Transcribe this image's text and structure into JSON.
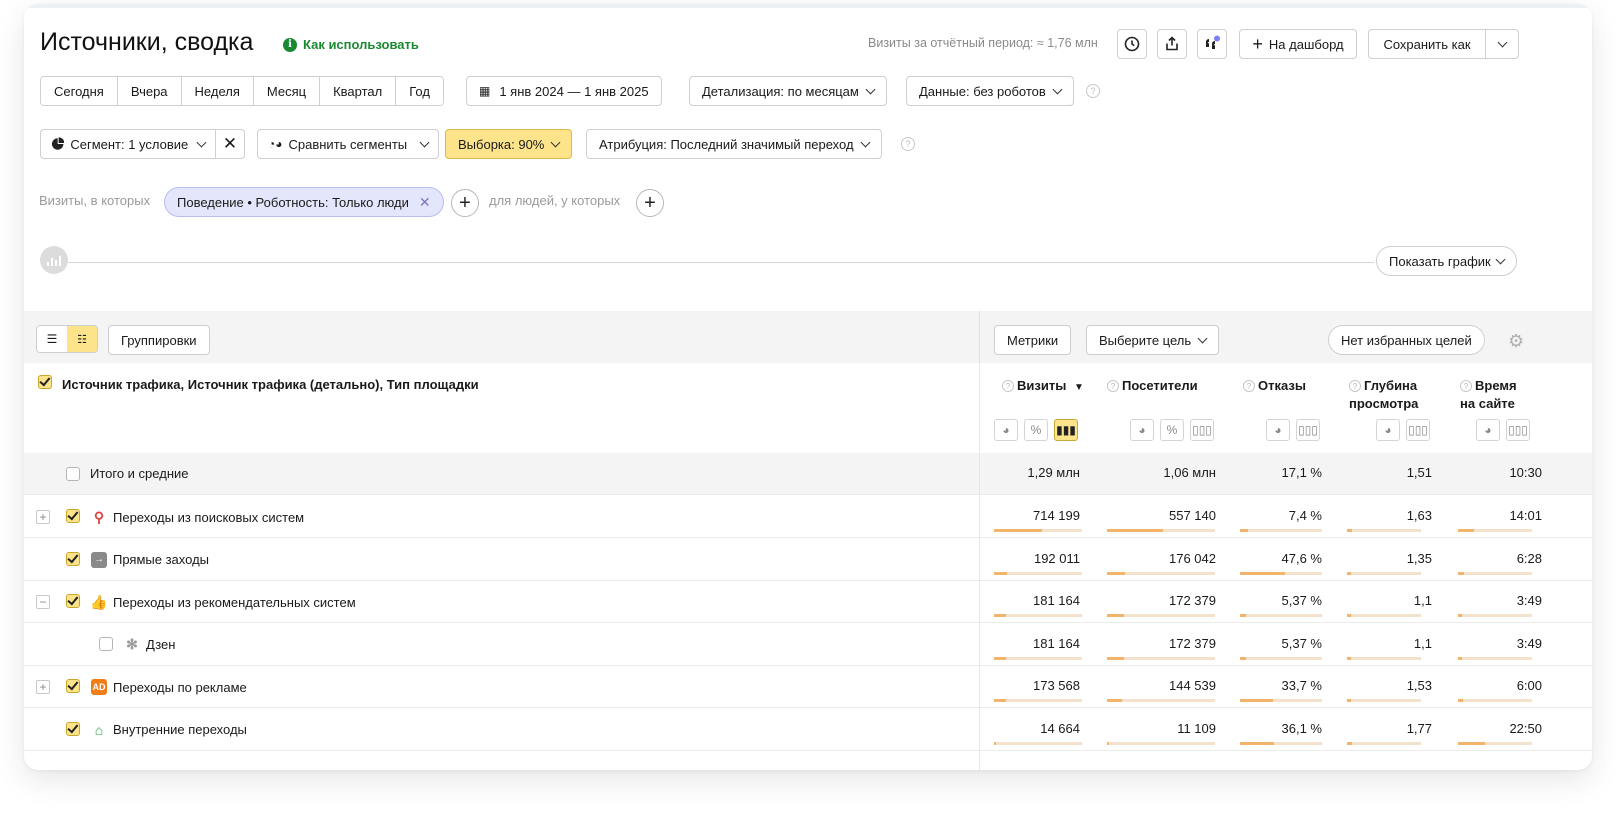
{
  "header": {
    "title": "Источники, сводка",
    "howto": "Как использовать",
    "visits_note": "Визиты за отчётный период: ≈ 1,76 млн",
    "to_dashboard": "На дашборд",
    "save_as": "Сохранить как"
  },
  "periods": [
    "Сегодня",
    "Вчера",
    "Неделя",
    "Месяц",
    "Квартал",
    "Год"
  ],
  "date_range": "1 янв 2024 — 1 янв 2025",
  "detail": "Детализация: по месяцам",
  "data_filter": "Данные: без роботов",
  "segment": "Сегмент: 1 условие",
  "compare": "Сравнить сегменты",
  "sample": "Выборка: 90%",
  "attribution": "Атрибуция: Последний значимый переход",
  "filter": {
    "visits_where": "Визиты, в которых",
    "chip": "Поведение • Роботность: Только люди",
    "people_where": "для людей, у которых"
  },
  "show_chart": "Показать график",
  "toolbar": {
    "groupings": "Группировки",
    "metrics": "Метрики",
    "goal": "Выберите цель",
    "no_fav": "Нет избранных целей"
  },
  "table": {
    "dimension": "Источник трафика, Источник трафика (детально), Тип площадки",
    "columns": [
      {
        "label": "Визиты",
        "sort": "▼"
      },
      {
        "label": "Посетители"
      },
      {
        "label": "Отказы"
      },
      {
        "label1": "Глубина",
        "label2": "просмотра"
      },
      {
        "label1": "Время",
        "label2": "на сайте"
      }
    ],
    "total": {
      "label": "Итого и средние",
      "values": [
        "1,29 млн",
        "1,06 млн",
        "17,1 %",
        "1,51",
        "10:30"
      ]
    },
    "rows": [
      {
        "label": "Переходы из поисковых систем",
        "expander": "+",
        "icon": "search-icon",
        "values": [
          "714 199",
          "557 140",
          "7,4 %",
          "1,63",
          "14:01"
        ],
        "fill": [
          0.55,
          0.52,
          0.1,
          0.07,
          0.22
        ]
      },
      {
        "label": "Прямые заходы",
        "expander": "",
        "icon": "direct-icon",
        "values": [
          "192 011",
          "176 042",
          "47,6 %",
          "1,35",
          "6:28"
        ],
        "fill": [
          0.15,
          0.17,
          0.55,
          0.06,
          0.08
        ]
      },
      {
        "label": "Переходы из рекомендательных систем",
        "expander": "−",
        "icon": "thumb-icon",
        "values": [
          "181 164",
          "172 379",
          "5,37 %",
          "1,1",
          "3:49"
        ],
        "fill": [
          0.14,
          0.16,
          0.07,
          0.05,
          0.05
        ]
      },
      {
        "label": "Дзен",
        "expander": "",
        "icon": "zen-icon",
        "child": true,
        "values": [
          "181 164",
          "172 379",
          "5,37 %",
          "1,1",
          "3:49"
        ],
        "fill": [
          0.14,
          0.16,
          0.07,
          0.05,
          0.05
        ]
      },
      {
        "label": "Переходы по рекламе",
        "expander": "+",
        "icon": "ad-icon",
        "ad_text": "AD",
        "values": [
          "173 568",
          "144 539",
          "33,7 %",
          "1,53",
          "6:00"
        ],
        "fill": [
          0.14,
          0.14,
          0.4,
          0.06,
          0.07
        ]
      },
      {
        "label": "Внутренние переходы",
        "expander": "",
        "icon": "home-icon",
        "values": [
          "14 664",
          "11 109",
          "36,1 %",
          "1,77",
          "22:50"
        ],
        "fill": [
          0.02,
          0.02,
          0.42,
          0.07,
          0.36
        ]
      }
    ]
  }
}
